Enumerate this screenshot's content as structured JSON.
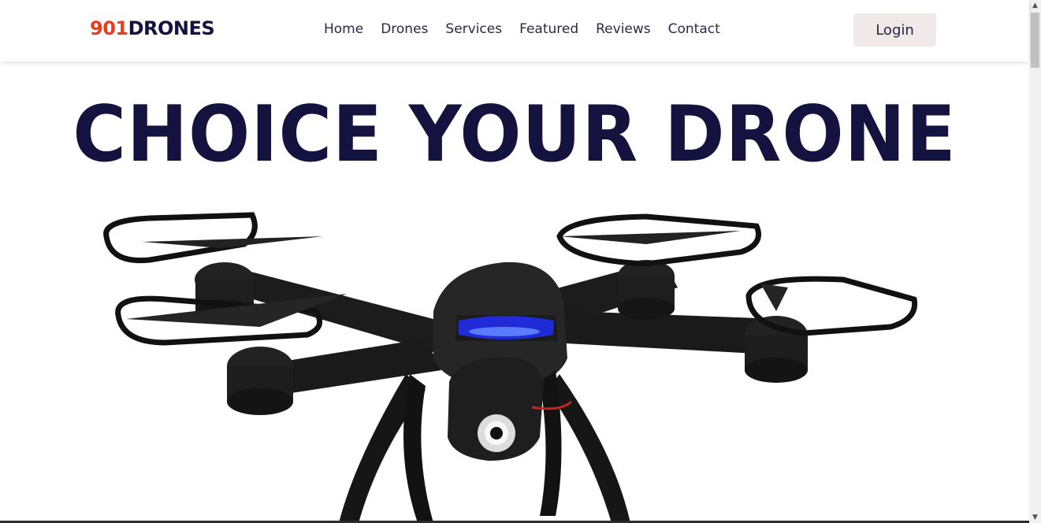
{
  "brand": {
    "accent_part": "901",
    "main_part": "DRONES",
    "accent_color": "#ea3b1b",
    "main_color": "#14123f"
  },
  "nav": {
    "links": [
      {
        "label": "Home"
      },
      {
        "label": "Drones"
      },
      {
        "label": "Services"
      },
      {
        "label": "Featured"
      },
      {
        "label": "Reviews"
      },
      {
        "label": "Contact"
      }
    ],
    "login_label": "Login"
  },
  "hero": {
    "title": "CHOICE YOUR DRONE"
  },
  "icons": {
    "scroll_up": "chevron-up-icon",
    "scroll_down": "chevron-down-icon"
  }
}
